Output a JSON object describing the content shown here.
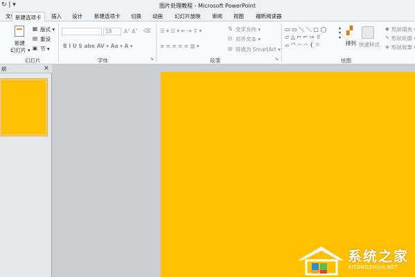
{
  "window": {
    "title": "图片处理教程 - Microsoft PowerPoint",
    "qat": "↻ | ▾"
  },
  "tabs": [
    "文件",
    "新建选项卡",
    "插入",
    "设计",
    "新建选项卡",
    "切换",
    "动画",
    "幻灯片放映",
    "审阅",
    "视图",
    "福昕阅读器"
  ],
  "ribbon": {
    "slides": {
      "new_slide": "新建",
      "new_slide2": "幻灯片 ▾",
      "layout": "版式 ▾",
      "reset": "重设",
      "section": "节 ▾",
      "label": "幻灯片"
    },
    "font": {
      "size": "18",
      "label": "字体",
      "buttons": "B  I  U  S  abe  AV ▾  Aa ▾  A ▾"
    },
    "paragraph": {
      "text_direction": "文字方向 ▾",
      "align_text": "对齐文本 ▾",
      "smartart": "转换为 SmartArt ▾",
      "label": "段落"
    },
    "drawing": {
      "arrange": "排列",
      "quick_styles": "快速样式",
      "shape_fill": "形状填充 ▾",
      "shape_outline": "形状轮廓 ▾",
      "shape_effects": "形状效果 ▾",
      "label": "绘图"
    }
  },
  "panel": {
    "tab_label": "纲",
    "close": "×"
  },
  "slide": {
    "fill_color": "#ffc000"
  },
  "watermark": {
    "name": "系统之家",
    "url": "XITONGZHIJIA.NET"
  }
}
